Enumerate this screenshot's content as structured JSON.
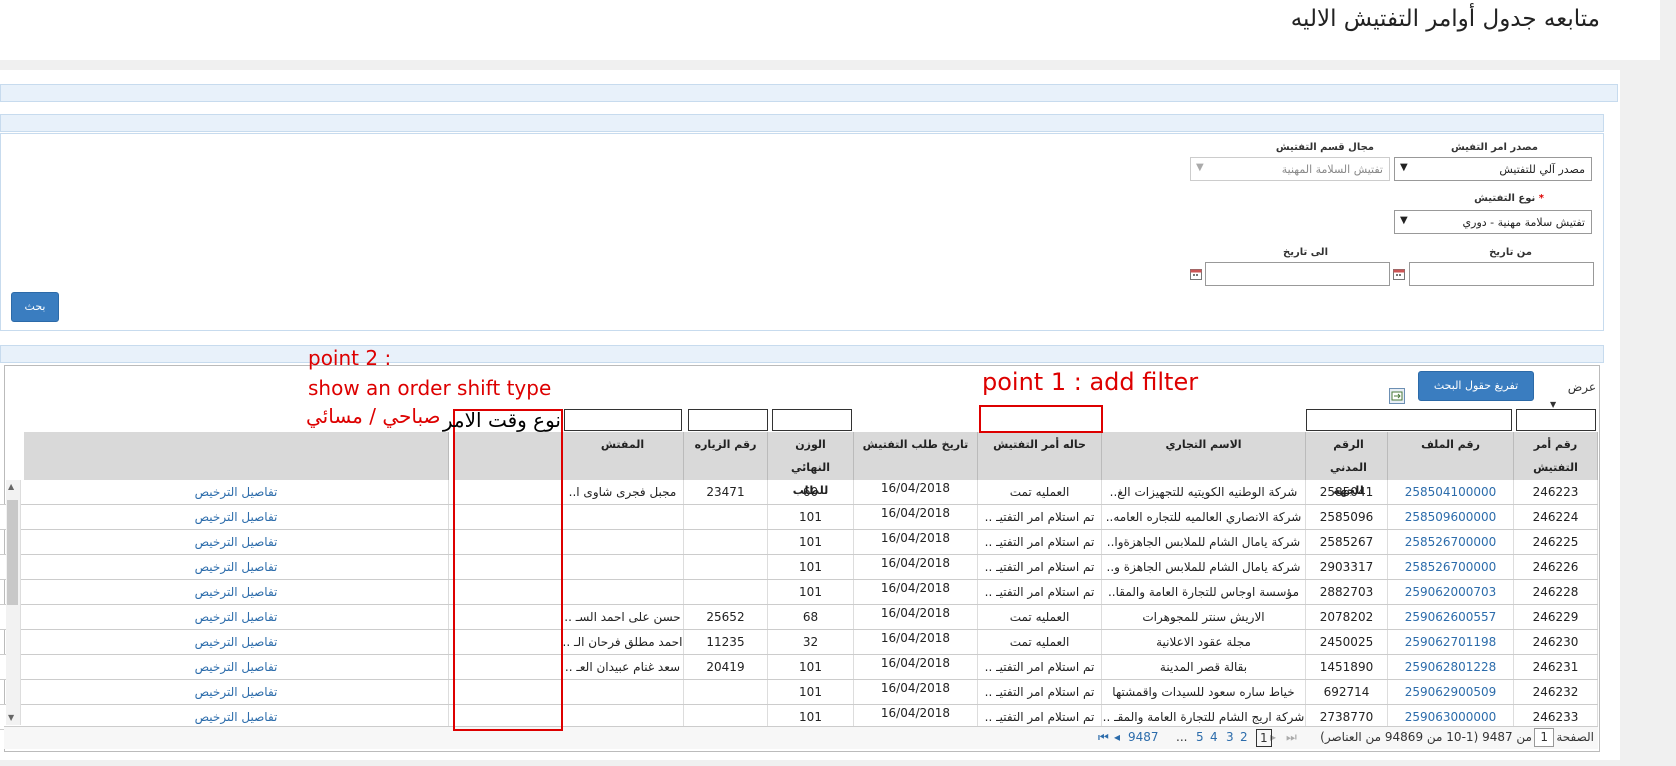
{
  "page": {
    "title": "متابعه جدول أوامر التفتيش الاليه"
  },
  "form": {
    "source_label": "مصدر امر التفيش",
    "source_value": "مصدر آلي للتفتيش",
    "section_label": "مجال قسم التفتيش",
    "section_value": "تفتيش السلامة المهنية",
    "type_label": "نوع التفتيش",
    "type_required": "*",
    "type_value": "تفتيش سلامة مهنية - دوري",
    "from_date_label": "من تاريخ",
    "to_date_label": "الى تاريخ",
    "search_button": "بحث"
  },
  "grid": {
    "clear_button": "تفريغ حقول البحث",
    "view_label": "عرض",
    "columns": [
      "رقم أمر التفتيش",
      "رقم الملف",
      "الرقم المدني للجهة",
      "الاسم التجاري",
      "حاله أمر التفتيش",
      "تاريخ طلب التفتيش",
      "الوزن النهائي للطلب",
      "رقم الزياره",
      "المفتش"
    ],
    "rows": [
      {
        "id": "246223",
        "file": "258504100000",
        "civil": "2585041",
        "name": "شركة الوطنيه الكويتيه للتجهيزات الغ..",
        "status": "العمليه تمت",
        "date": "16/04/2018",
        "weight": "60",
        "visit": "23471",
        "inspector": "مجبل فجرى شاوى ا..",
        "details": "تفاصيل الترخيص"
      },
      {
        "id": "246224",
        "file": "258509600000",
        "civil": "2585096",
        "name": "شركة الانصاري العالميه للتجاره العامه..",
        "status": "تم استلام امر التفتيـ ..",
        "date": "16/04/2018",
        "weight": "101",
        "visit": "",
        "inspector": "",
        "details": "تفاصيل الترخيص"
      },
      {
        "id": "246225",
        "file": "258526700000",
        "civil": "2585267",
        "name": "شركة يامال الشام للملابس الجاهزةوا..",
        "status": "تم استلام امر التفتيـ ..",
        "date": "16/04/2018",
        "weight": "101",
        "visit": "",
        "inspector": "",
        "details": "تفاصيل الترخيص"
      },
      {
        "id": "246226",
        "file": "258526700000",
        "civil": "2903317",
        "name": "شركة يامال الشام للملابس الجاهزة و..",
        "status": "تم استلام امر التفتيـ ..",
        "date": "16/04/2018",
        "weight": "101",
        "visit": "",
        "inspector": "",
        "details": "تفاصيل الترخيص"
      },
      {
        "id": "246228",
        "file": "259062000703",
        "civil": "2882703",
        "name": "مؤسسة اوجاس للتجارة العامة والمقا..",
        "status": "تم استلام امر التفتيـ ..",
        "date": "16/04/2018",
        "weight": "101",
        "visit": "",
        "inspector": "",
        "details": "تفاصيل الترخيص"
      },
      {
        "id": "246229",
        "file": "259062600557",
        "civil": "2078202",
        "name": "الاريش سنتر للمجوهرات",
        "status": "العمليه تمت",
        "date": "16/04/2018",
        "weight": "68",
        "visit": "25652",
        "inspector": "حسن على احمد السـ ..",
        "details": "تفاصيل الترخيص"
      },
      {
        "id": "246230",
        "file": "259062701198",
        "civil": "2450025",
        "name": "مجلة عقود الاعلانية",
        "status": "العمليه تمت",
        "date": "16/04/2018",
        "weight": "32",
        "visit": "11235",
        "inspector": "احمد مطلق فرحان الـ ..",
        "details": "تفاصيل الترخيص"
      },
      {
        "id": "246231",
        "file": "259062801228",
        "civil": "1451890",
        "name": "بقالة قصر المدينة",
        "status": "تم استلام امر التفتيـ ..",
        "date": "16/04/2018",
        "weight": "101",
        "visit": "20419",
        "inspector": "سعد غنام عبيدان العـ ..",
        "details": "تفاصيل الترخيص"
      },
      {
        "id": "246232",
        "file": "259062900509",
        "civil": "692714",
        "name": "خياط ساره سعود للسيدات واقمشتها",
        "status": "تم استلام امر التفتيـ ..",
        "date": "16/04/2018",
        "weight": "101",
        "visit": "",
        "inspector": "",
        "details": "تفاصيل الترخيص"
      },
      {
        "id": "246233",
        "file": "259063000000",
        "civil": "2738770",
        "name": "شركة اريج الشام للتجارة العامة والمقـ ..",
        "status": "تم استلام امر التفتيـ ..",
        "date": "16/04/2018",
        "weight": "101",
        "visit": "",
        "inspector": "",
        "details": "تفاصيل الترخيص"
      }
    ]
  },
  "pager": {
    "page_label": "الصفحة",
    "current_page": "1",
    "of_pages": "من 9487 (1-10 من 94869 من العناصر)",
    "pages": [
      "1",
      "2",
      "3",
      "4",
      "5",
      "...",
      "9487"
    ]
  },
  "annotations": {
    "point1": "point 1 : add filter",
    "point2_line1": "point 2 :",
    "point2_line2": "show an order shift type",
    "point2_line3": "صباحي / مسائي",
    "new_column": "نوع وقت الامر"
  },
  "colors": {
    "annotation": "#dd0000",
    "link": "#2c6cab",
    "button": "#3a7dc0"
  }
}
